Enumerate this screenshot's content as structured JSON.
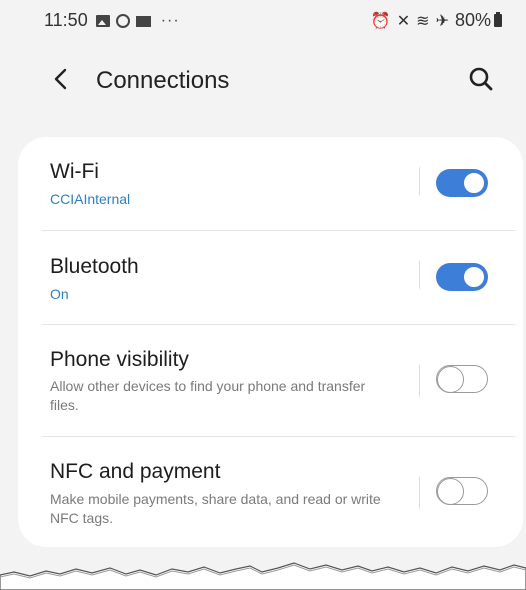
{
  "status_bar": {
    "time": "11:50",
    "left_icons": [
      "gallery-icon",
      "whatsapp-icon",
      "mail-icon"
    ],
    "more": "···",
    "battery": "80%",
    "right_icons": [
      "alarm-icon",
      "mute-icon",
      "wifi-icon",
      "airplane-icon",
      "battery-icon"
    ]
  },
  "header": {
    "title": "Connections"
  },
  "settings": [
    {
      "title": "Wi-Fi",
      "subtitle": "CCIAInternal",
      "toggle": true
    },
    {
      "title": "Bluetooth",
      "subtitle": "On",
      "toggle": true
    },
    {
      "title": "Phone visibility",
      "subtitle": "Allow other devices to find your phone and transfer files.",
      "toggle": false
    },
    {
      "title": "NFC and payment",
      "subtitle": "Make mobile payments, share data, and read or write NFC tags.",
      "toggle": false
    }
  ],
  "colors": {
    "accent": "#3d7fd8",
    "link_text": "#2f7fc1",
    "background": "#f3f3f3",
    "card": "#ffffff"
  }
}
